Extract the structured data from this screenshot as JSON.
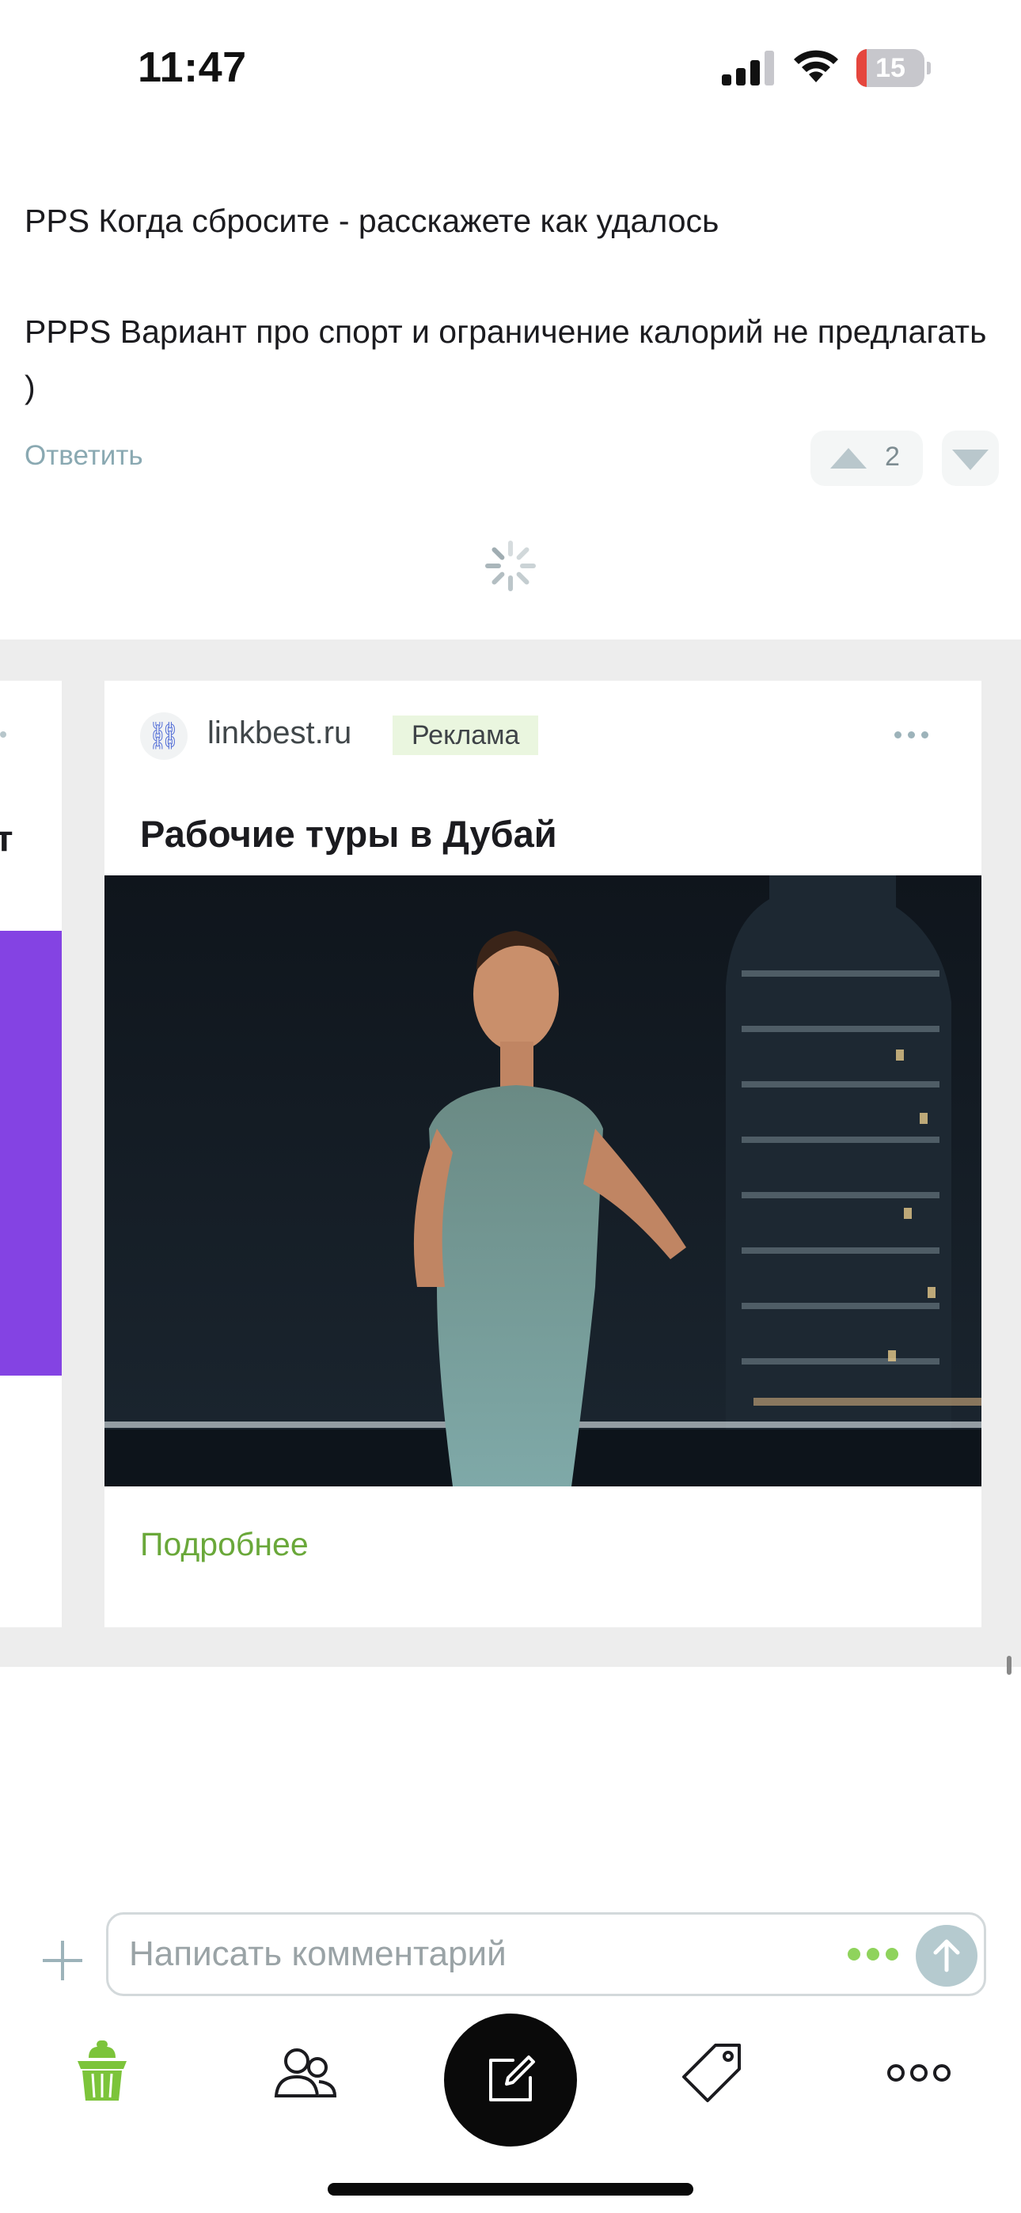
{
  "status_bar": {
    "time": "11:47",
    "battery_level": "15",
    "battery_fraction": 0.15
  },
  "comment": {
    "lines": [
      "PPS Когда сбросите - расскажете как удалось",
      "PPPS Вариант про спорт и ограничение калорий не предлагать )"
    ],
    "reply_label": "Ответить",
    "vote_count": "2"
  },
  "ad": {
    "domain": "linkbest.ru",
    "badge": "Реклама",
    "title": "Рабочие туры в Дубай",
    "cta": "Подробнее",
    "logo_icon": "link-icon",
    "image_subject": "woman-in-evening-dress-city-night-photo",
    "side_card_accent": "#8443e3",
    "side_card_title_fragment": "т"
  },
  "composer": {
    "placeholder": "Написать комментарий"
  },
  "tab_bar": {
    "items": [
      "home-icon",
      "people-icon",
      "compose-icon",
      "tag-icon",
      "more-icon"
    ],
    "active": "home-icon",
    "accent": "#7cc43a"
  }
}
